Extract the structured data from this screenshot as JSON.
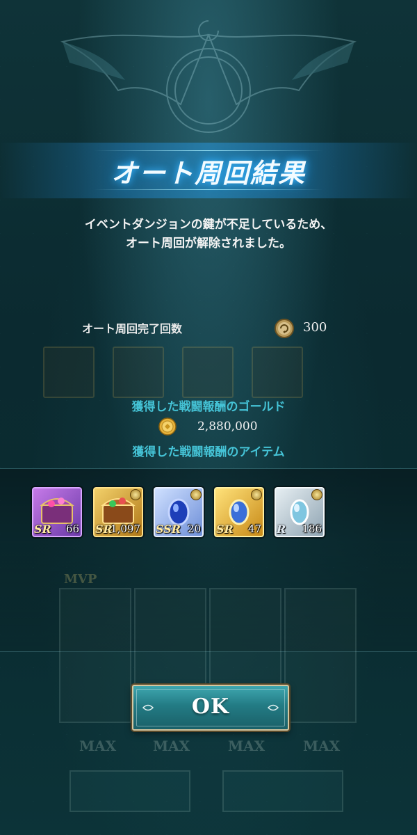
{
  "dialog": {
    "title": "オート周回結果",
    "message_line1": "イベントダンジョンの鍵が不足しているため、",
    "message_line2": "オート周回が解除されました。"
  },
  "auto_count": {
    "label": "オート周回完了回数",
    "value": "300",
    "icon": "auto-loop-icon"
  },
  "gold": {
    "heading": "獲得した戦闘報酬のゴールド",
    "value": "2,880,000",
    "icon": "gold-coin-icon"
  },
  "items": {
    "heading": "獲得した戦闘報酬のアイテム",
    "list": [
      {
        "name": "item-sr-chest-purple",
        "rarity": "SR",
        "qty": "66",
        "frame_color": "#8a5ad0"
      },
      {
        "name": "item-sr-chest-gold",
        "rarity": "SR",
        "qty": "1,097",
        "frame_color": "#d9a630"
      },
      {
        "name": "item-ssr-gem-blue",
        "rarity": "SSR",
        "qty": "20",
        "frame_color": "#8fb0f0"
      },
      {
        "name": "item-sr-gem-gold",
        "rarity": "SR",
        "qty": "47",
        "frame_color": "#e0b840"
      },
      {
        "name": "item-r-gem-silver",
        "rarity": "R",
        "qty": "186",
        "frame_color": "#9fb3c0"
      }
    ]
  },
  "ok_button": {
    "label": "OK"
  }
}
